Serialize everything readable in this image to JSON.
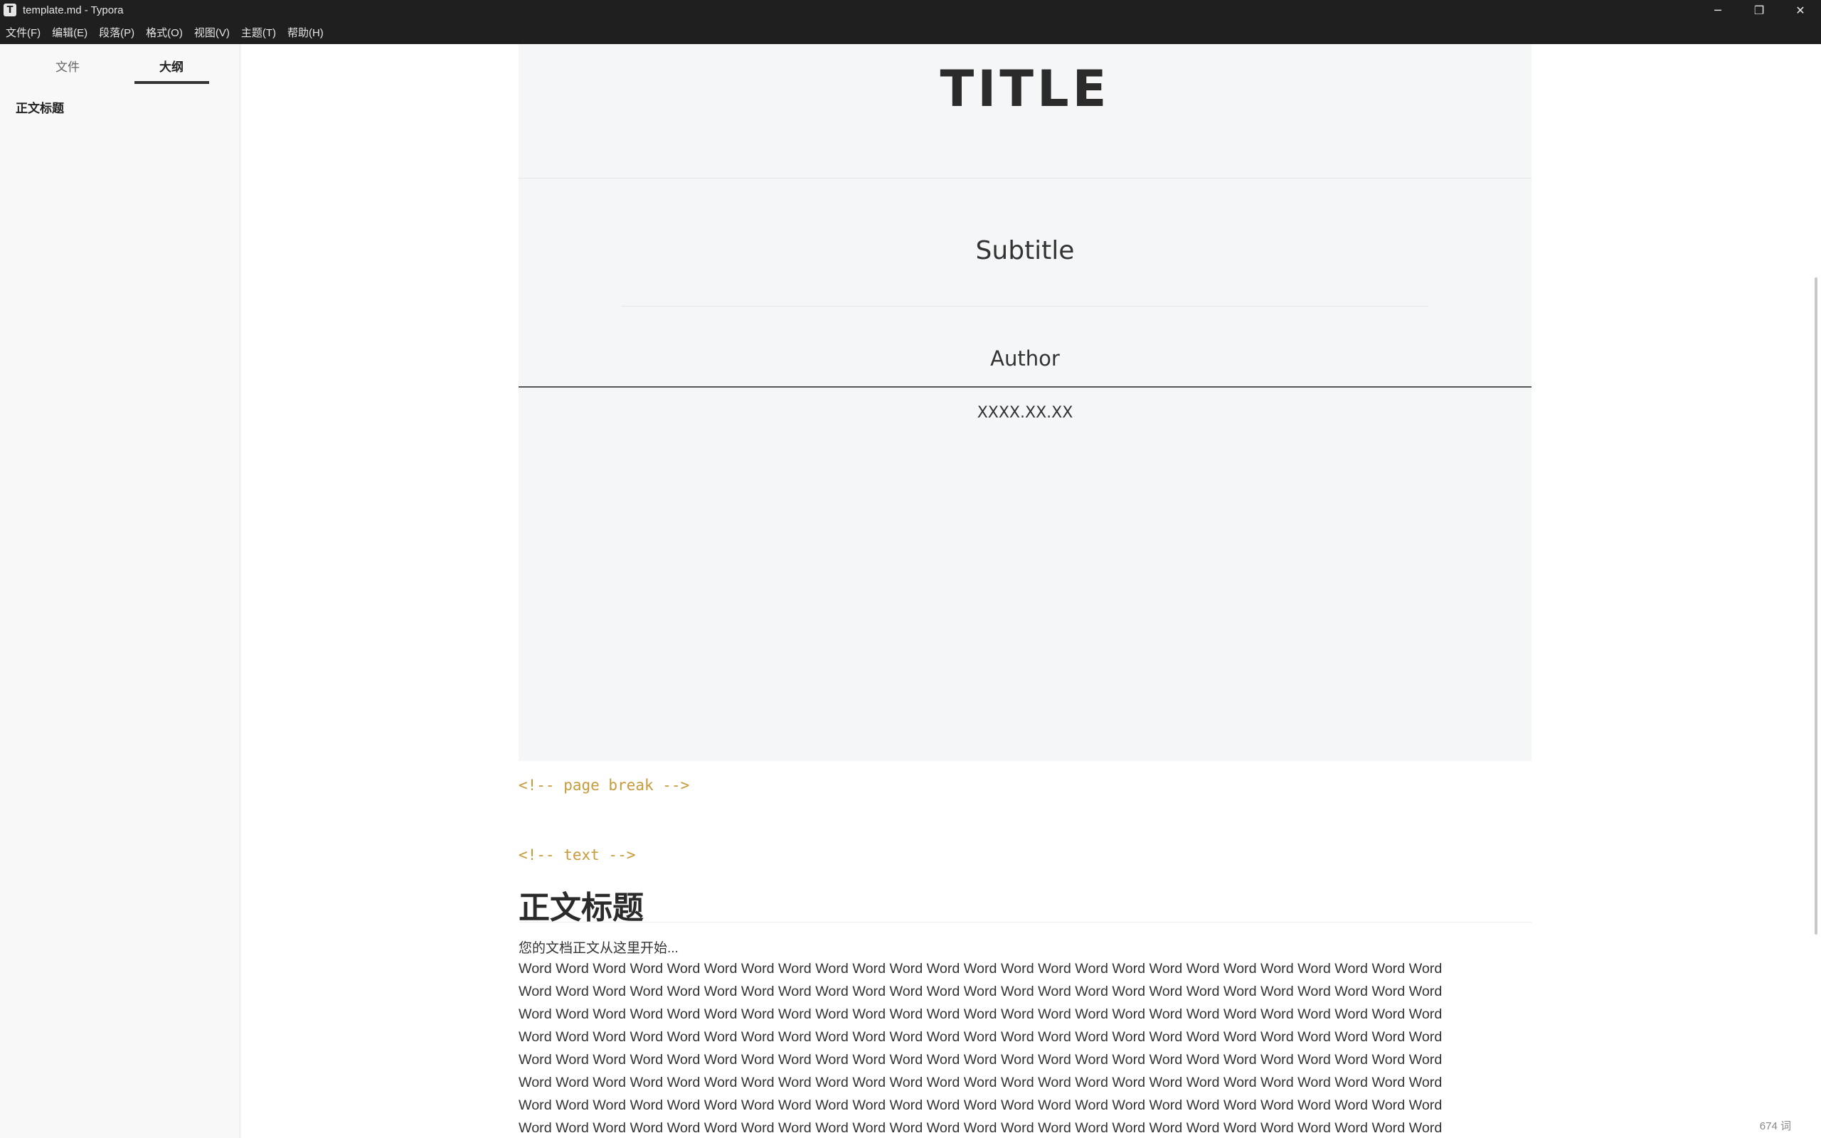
{
  "window": {
    "title": "template.md - Typora",
    "app_icon_letter": "T",
    "controls": [
      "─",
      "❐",
      "✕"
    ]
  },
  "menu": [
    "文件(F)",
    "编辑(E)",
    "段落(P)",
    "格式(O)",
    "视图(V)",
    "主题(T)",
    "帮助(H)"
  ],
  "sidebar": {
    "tabs": [
      "文件",
      "大纲"
    ],
    "active_tab": "大纲",
    "outline": [
      "正文标题"
    ],
    "footer_icons": [
      "chevron-left-icon",
      "source-code-icon"
    ]
  },
  "cover": {
    "title": "TITLE",
    "subtitle": "Subtitle",
    "author": "Author",
    "date": "XXXX.XX.XX"
  },
  "comments": {
    "page_break": "<!-- page break -->",
    "text": "<!-- text -->"
  },
  "body": {
    "heading": "正文标题",
    "intro": "您的文档正文从这里开始...",
    "word_line": "Word Word Word Word Word Word Word Word Word Word Word Word Word Word Word Word Word Word Word Word Word Word Word Word Word",
    "line_count": 8
  },
  "status": {
    "word_count": "674 词"
  }
}
